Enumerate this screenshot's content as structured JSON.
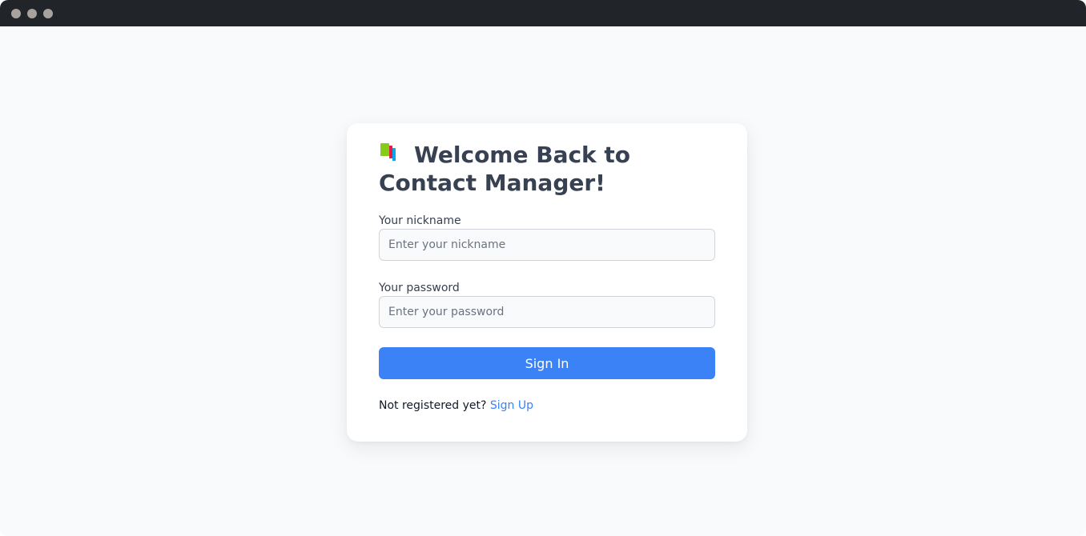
{
  "window": {
    "dots_color": "#a8a29e",
    "titlebar_color": "#212529"
  },
  "card": {
    "title_icon": "books-icon",
    "title": "Welcome Back to Contact Manager!"
  },
  "form": {
    "nickname_label": "Your nickname",
    "nickname_placeholder": "Enter your nickname",
    "nickname_value": "",
    "password_label": "Your password",
    "password_placeholder": "Enter your password",
    "password_value": "",
    "submit_label": "Sign In"
  },
  "footer": {
    "prompt": "Not registered yet?",
    "signup_link": "Sign Up"
  },
  "colors": {
    "accent": "#3b82f6",
    "text": "#374151",
    "background": "#f9fafb"
  }
}
